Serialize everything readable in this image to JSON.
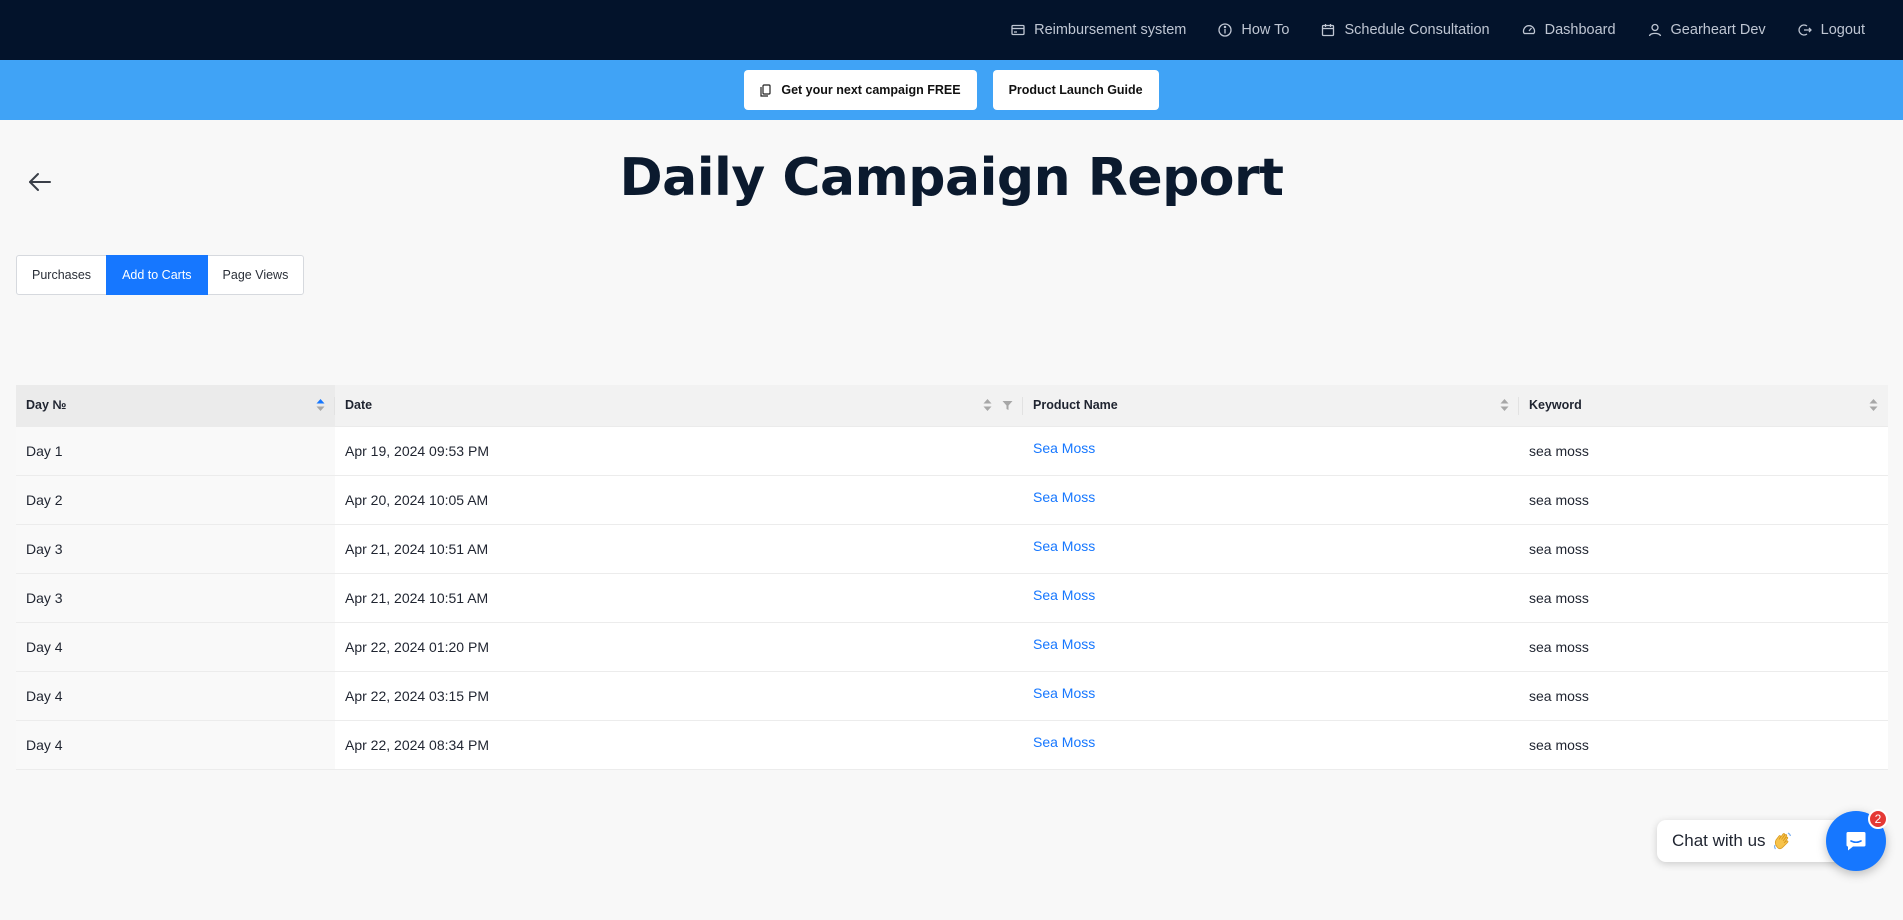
{
  "nav": {
    "items": [
      {
        "label": "Reimbursement system",
        "icon": "credit-card-icon"
      },
      {
        "label": "How To",
        "icon": "info-circle-icon"
      },
      {
        "label": "Schedule Consultation",
        "icon": "calendar-icon"
      },
      {
        "label": "Dashboard",
        "icon": "dashboard-gauge-icon"
      },
      {
        "label": "Gearheart Dev",
        "icon": "user-icon"
      },
      {
        "label": "Logout",
        "icon": "logout-icon"
      }
    ]
  },
  "promo": {
    "free_campaign": "Get your next campaign FREE",
    "launch_guide": "Product Launch Guide"
  },
  "page": {
    "title": "Daily Campaign Report"
  },
  "tabs": [
    {
      "label": "Purchases",
      "active": false
    },
    {
      "label": "Add to Carts",
      "active": true
    },
    {
      "label": "Page Views",
      "active": false
    }
  ],
  "table": {
    "columns": [
      "Day №",
      "Date",
      "Product Name",
      "Keyword"
    ],
    "rows": [
      {
        "day": "Day 1",
        "date": "Apr 19, 2024 09:53 PM",
        "product": "Sea Moss",
        "keyword": "sea moss"
      },
      {
        "day": "Day 2",
        "date": "Apr 20, 2024 10:05 AM",
        "product": "Sea Moss",
        "keyword": "sea moss"
      },
      {
        "day": "Day 3",
        "date": "Apr 21, 2024 10:51 AM",
        "product": "Sea Moss",
        "keyword": "sea moss"
      },
      {
        "day": "Day 3",
        "date": "Apr 21, 2024 10:51 AM",
        "product": "Sea Moss",
        "keyword": "sea moss"
      },
      {
        "day": "Day 4",
        "date": "Apr 22, 2024 01:20 PM",
        "product": "Sea Moss",
        "keyword": "sea moss"
      },
      {
        "day": "Day 4",
        "date": "Apr 22, 2024 03:15 PM",
        "product": "Sea Moss",
        "keyword": "sea moss"
      },
      {
        "day": "Day 4",
        "date": "Apr 22, 2024 08:34 PM",
        "product": "Sea Moss",
        "keyword": "sea moss"
      }
    ]
  },
  "chat": {
    "label": "Chat with us",
    "badge": "2"
  },
  "colors": {
    "nav_bg": "#03132b",
    "promo_bg": "#40a3f6",
    "accent": "#1677ff",
    "badge": "#e53935"
  }
}
